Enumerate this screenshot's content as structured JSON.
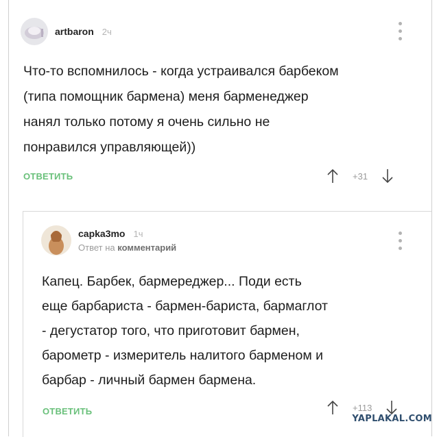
{
  "comments": [
    {
      "username": "artbaron",
      "time": "2ч",
      "text_lines": [
        "Что-то вспомнилось - когда устраивался барбеком",
        "(типа помощник бармена) меня барменеджер",
        "нанял только потому я очень сильно не",
        "понравился управляющей))"
      ],
      "reply_label": "ОТВЕТИТЬ",
      "score": "+31"
    },
    {
      "username": "capka3mo",
      "time": "1ч",
      "reply_prefix": "Ответ на",
      "reply_target": "комментарий",
      "text_lines": [
        "Капец. Барбек, бармереджер... Поди есть",
        "еще барбариста - бармен-бариста, бармаглот",
        "- дегустатор того, что приготовит бармен,",
        "барометр - измеритель налитого барменом и",
        "барбар - личный бармен бармена."
      ],
      "reply_label": "ОТВЕТИТЬ",
      "score": "+113"
    }
  ],
  "watermark": "YAPLAKAL.COM",
  "colors": {
    "reply": "#69c07a",
    "muted": "#9a9a9a",
    "text": "#1d1d1d"
  },
  "icons": [
    "avatar-artbaron",
    "avatar-capka3mo",
    "more-vertical-icon",
    "arrow-up-icon",
    "arrow-down-icon"
  ]
}
